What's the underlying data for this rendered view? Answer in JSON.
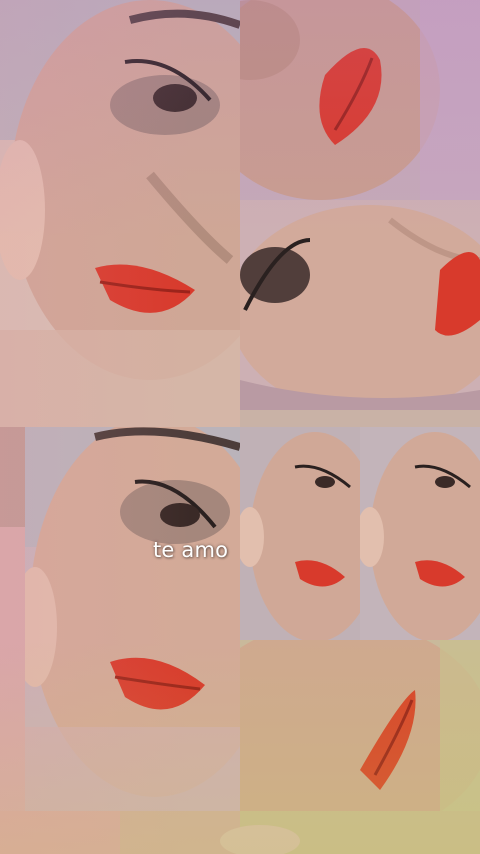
{
  "caption": {
    "text": "te amo"
  },
  "colors": {
    "lip_red": "#d83a2c",
    "skin": "#c8a391",
    "wall": "#b9b4b8",
    "tint_top": "#c07ac8",
    "tint_bottom": "#c8d25a"
  },
  "photos": [
    "face-closeup",
    "lips-closeup",
    "face-rotated",
    "face-large",
    "face-small-a",
    "face-small-b",
    "lips-rotated",
    "strip-bottom"
  ]
}
